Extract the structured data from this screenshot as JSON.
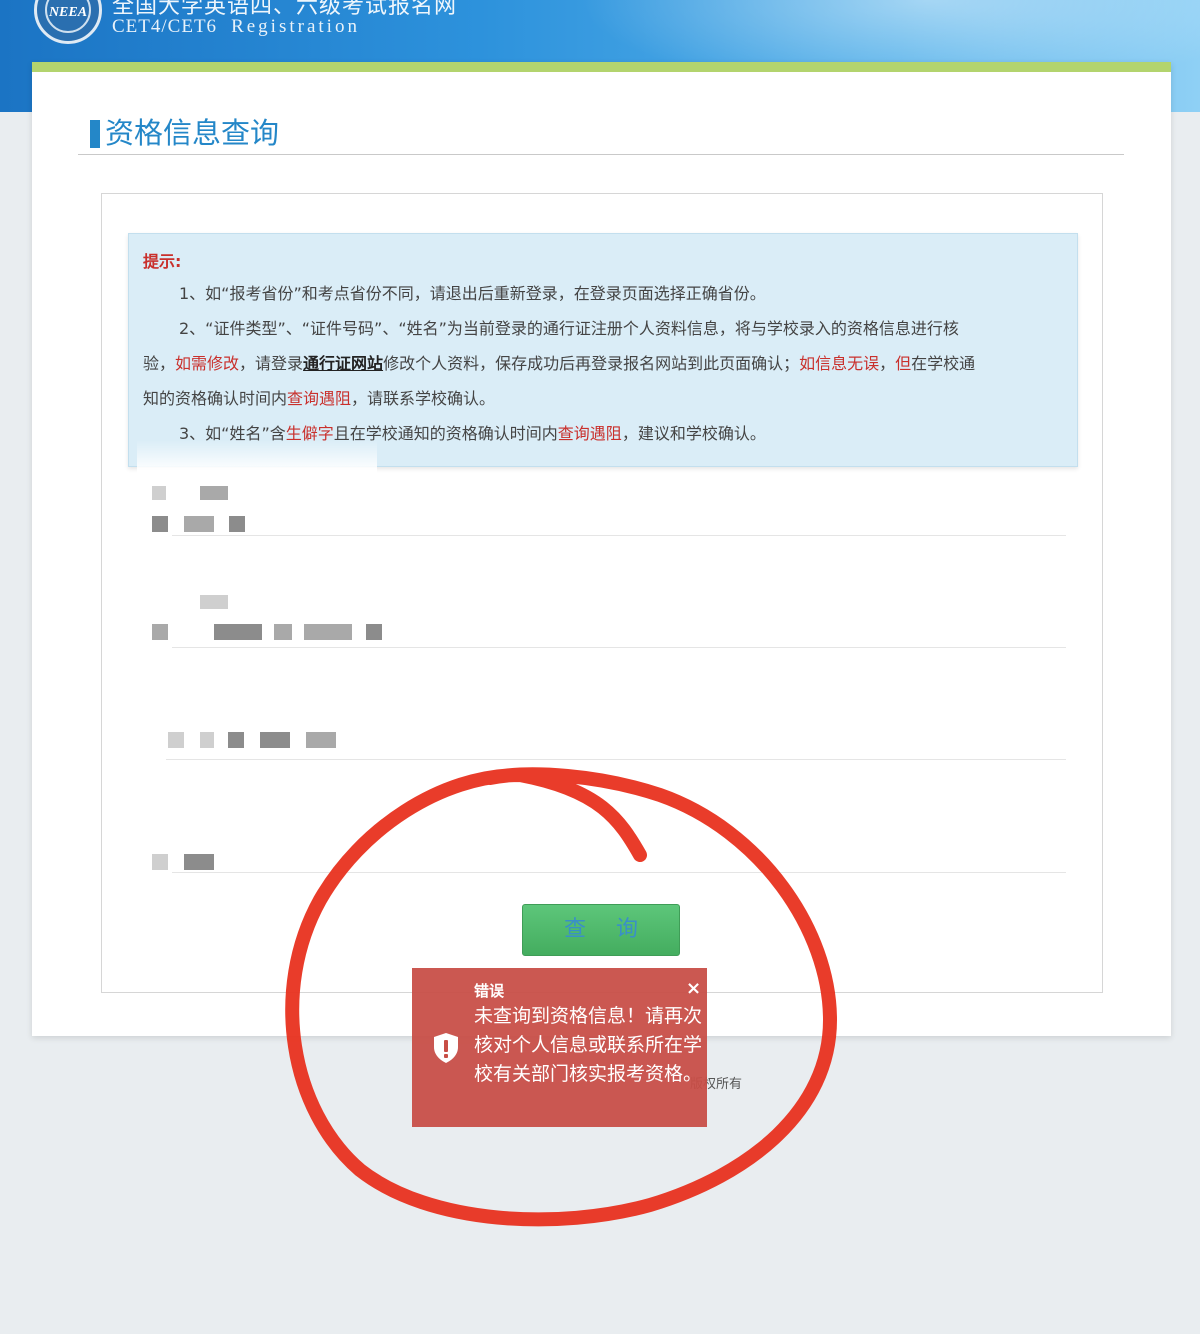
{
  "header": {
    "logo_text": "NEEA",
    "site_title": "全国大学英语四、六级考试报名网",
    "site_subtitle": "CET4/CET6",
    "site_subtitle_reg": "Registration"
  },
  "main": {
    "page_title": "资格信息查询",
    "notice": {
      "title": "提示:",
      "item1": "1、如“报考省份”和考点省份不同，请退出后重新登录，在登录页面选择正确省份。",
      "item2_a": "2、“证件类型”、“证件号码”、“姓名”为当前登录的通行证注册个人资料信息，将与学校录入的资格信息进行核",
      "item2_b1": "验，",
      "item2_b2": "如需修改",
      "item2_b3": "，请登录",
      "item2_b4": "通行证网站",
      "item2_b5": "修改个人资料，保存成功后再登录报名网站到此页面确认；",
      "item2_b6": "如信息无误",
      "item2_b7": "，",
      "item2_b8": "但",
      "item2_b9": "在学校通",
      "item2_c1": "知的资格确认时间内",
      "item2_c2": "查询遇阻",
      "item2_c3": "，请联系学校确认。",
      "item3_a": "3、如“姓名”含",
      "item3_b": "生僻字",
      "item3_c": "且在学校通知的资格确认时间内",
      "item3_d": "查询遇阻",
      "item3_e": "，建议和学校确认。"
    },
    "query_button": "查询"
  },
  "footer": {
    "partial_text": "版权所有"
  },
  "toast": {
    "title": "错误",
    "close": "×",
    "message": "未查询到资格信息！请再次核对个人信息或联系所在学校有关部门核实报考资格。"
  },
  "colors": {
    "accent": "#2487c8",
    "warning_red": "#c9302c",
    "button_green": "#4cb567",
    "toast_bg": "#c84e46",
    "annotation_red": "#e8321f"
  }
}
